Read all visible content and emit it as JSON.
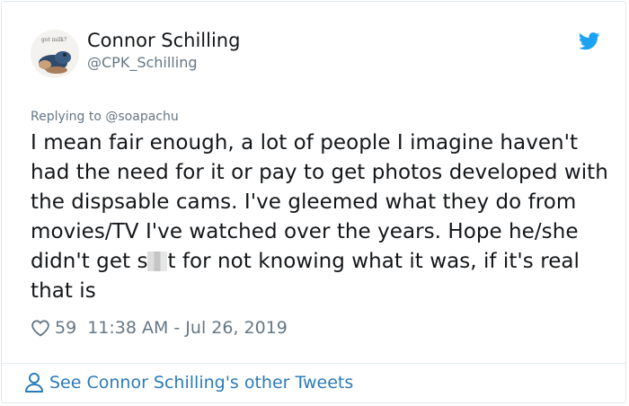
{
  "author": {
    "display_name": "Connor Schilling",
    "handle": "@CPK_Schilling",
    "avatar_icon": "avatar-photo",
    "avatar_caption": "got milk?"
  },
  "tweet": {
    "replying_to": "Replying to @soapachu",
    "text_before_censor": "I mean fair enough, a lot of people I imagine haven't had the need for it or pay to get photos developed with the dispsable cams. I've gleemed what they do from movies/TV I've watched over the years. Hope he/she didn't get s",
    "text_after_censor": "t for not knowing what it was, if it's real that is",
    "likes": "59",
    "timestamp": "11:38 AM - Jul 26, 2019"
  },
  "footer": {
    "link_label": "See Connor Schilling's other Tweets",
    "icon": "user-icon"
  },
  "icons": {
    "brand": "twitter-bird-icon",
    "like": "heart-icon"
  },
  "colors": {
    "twitter_blue": "#1da1f2",
    "link_blue": "#2b7bb9",
    "secondary_text": "#657786",
    "primary_text": "#14171a",
    "border": "#e1e8ed"
  }
}
